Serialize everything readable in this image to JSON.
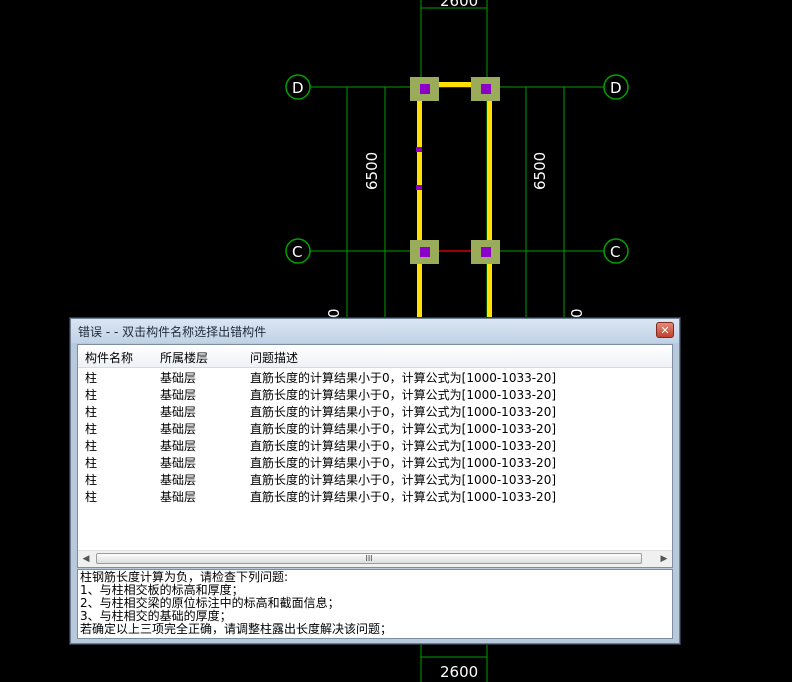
{
  "drawing": {
    "dim_top": "2600",
    "dim_bottom": "2600",
    "dim_left": "6500",
    "dim_right": "6500",
    "axis_d_left": "D",
    "axis_d_right": "D",
    "axis_c_left": "C",
    "axis_c_right": "C",
    "partial_dim_left": "0",
    "partial_dim_right": "0",
    "colors": {
      "grid": "#00a000",
      "beam": "#ffe000",
      "column": "#9aab5a",
      "marker": "#8a00c8"
    }
  },
  "dialog": {
    "title": "错误 - - 双击构件名称选择出错构件",
    "close_icon": "close-icon",
    "columns": [
      "构件名称",
      "所属楼层",
      "问题描述"
    ],
    "rows": [
      [
        "柱",
        "基础层",
        "直筋长度的计算结果小于0，计算公式为[1000-1033-20]"
      ],
      [
        "柱",
        "基础层",
        "直筋长度的计算结果小于0，计算公式为[1000-1033-20]"
      ],
      [
        "柱",
        "基础层",
        "直筋长度的计算结果小于0，计算公式为[1000-1033-20]"
      ],
      [
        "柱",
        "基础层",
        "直筋长度的计算结果小于0，计算公式为[1000-1033-20]"
      ],
      [
        "柱",
        "基础层",
        "直筋长度的计算结果小于0，计算公式为[1000-1033-20]"
      ],
      [
        "柱",
        "基础层",
        "直筋长度的计算结果小于0，计算公式为[1000-1033-20]"
      ],
      [
        "柱",
        "基础层",
        "直筋长度的计算结果小于0，计算公式为[1000-1033-20]"
      ],
      [
        "柱",
        "基础层",
        "直筋长度的计算结果小于0，计算公式为[1000-1033-20]"
      ]
    ],
    "scroll_grip": "III",
    "detail_lines": [
      "柱钢筋长度计算为负，请检查下列问题:",
      " 1、与柱相交板的标高和厚度；",
      " 2、与柱相交梁的原位标注中的标高和截面信息；",
      " 3、与柱相交的基础的厚度；",
      " 若确定以上三项完全正确，请调整柱露出长度解决该问题；"
    ]
  }
}
